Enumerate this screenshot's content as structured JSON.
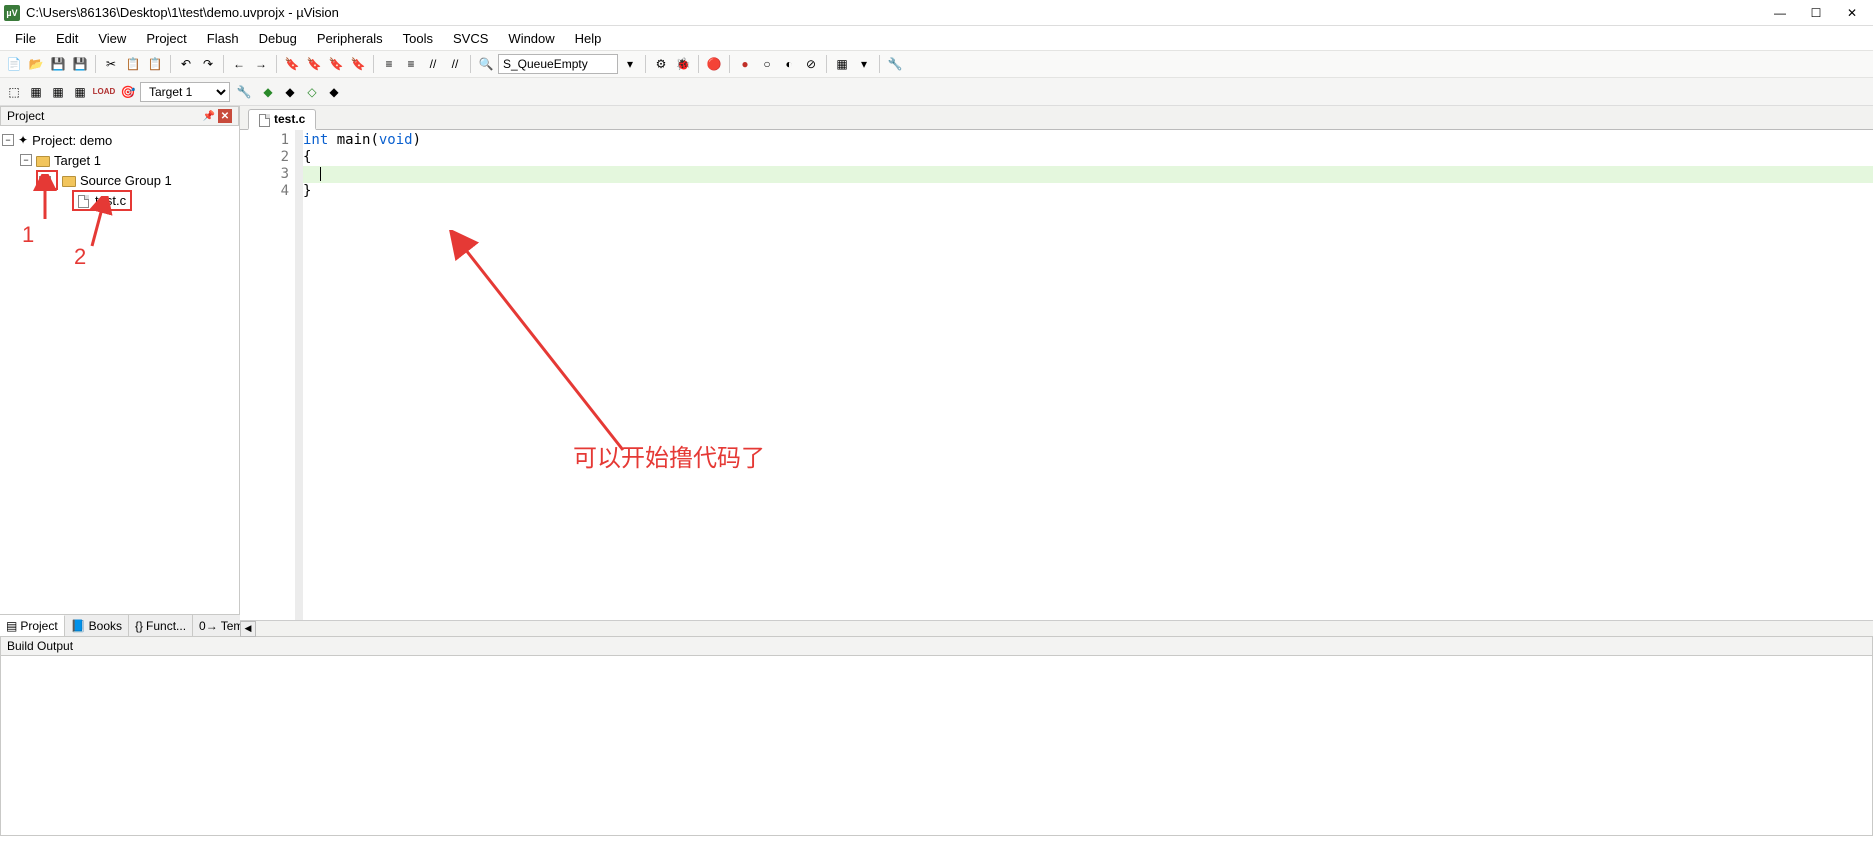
{
  "titlebar": {
    "title": "C:\\Users\\86136\\Desktop\\1\\test\\demo.uvprojx - µVision"
  },
  "menu": [
    "File",
    "Edit",
    "View",
    "Project",
    "Flash",
    "Debug",
    "Peripherals",
    "Tools",
    "SVCS",
    "Window",
    "Help"
  ],
  "toolbar1": {
    "find_combo": "S_QueueEmpty"
  },
  "toolbar2": {
    "target_select": "Target 1"
  },
  "project_panel": {
    "title": "Project",
    "root": "Project: demo",
    "target": "Target 1",
    "group": "Source Group 1",
    "file": "test.c"
  },
  "panel_tabs": {
    "project": "Project",
    "books": "Books",
    "functions": "Funct...",
    "templates": "Temp..."
  },
  "editor": {
    "active_tab": "test.c",
    "lines": [
      {
        "n": "1",
        "pre": "",
        "kw": "int",
        "mid": " main(",
        "kw2": "void",
        "post": ")"
      },
      {
        "n": "2",
        "text": "{"
      },
      {
        "n": "3",
        "text": "",
        "cursor": true
      },
      {
        "n": "4",
        "text": "}"
      }
    ]
  },
  "build_output": {
    "title": "Build Output"
  },
  "annotations": {
    "label1": "1",
    "label2": "2",
    "note": "可以开始撸代码了"
  }
}
